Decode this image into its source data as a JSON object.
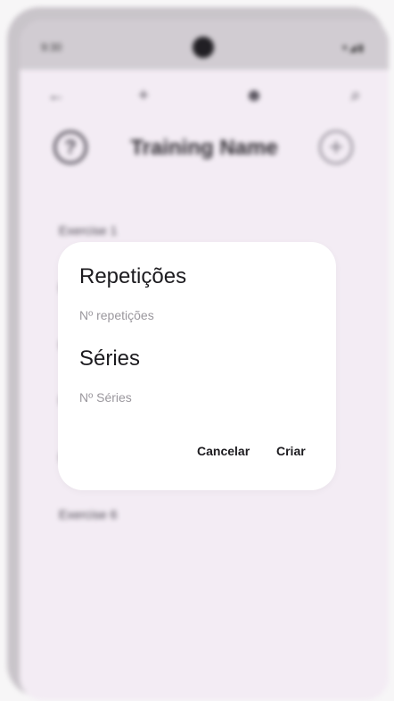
{
  "status_bar": {
    "time": "9:30",
    "icons": "▾◢▮"
  },
  "top_bar": {
    "back_icon": "←",
    "add_icon": "+",
    "profile_icon": "☻",
    "search_icon": "⌕"
  },
  "header": {
    "title": "Training Name",
    "help_icon": "?",
    "add_icon": "+"
  },
  "exercises": [
    "Exercise 1",
    "E",
    "E",
    "E",
    "E",
    "Exercise 6"
  ],
  "dialog": {
    "reps_heading": "Repetições",
    "reps_placeholder": "Nº repetições",
    "sets_heading": "Séries",
    "sets_placeholder": "Nº Séries",
    "cancel_label": "Cancelar",
    "create_label": "Criar"
  }
}
